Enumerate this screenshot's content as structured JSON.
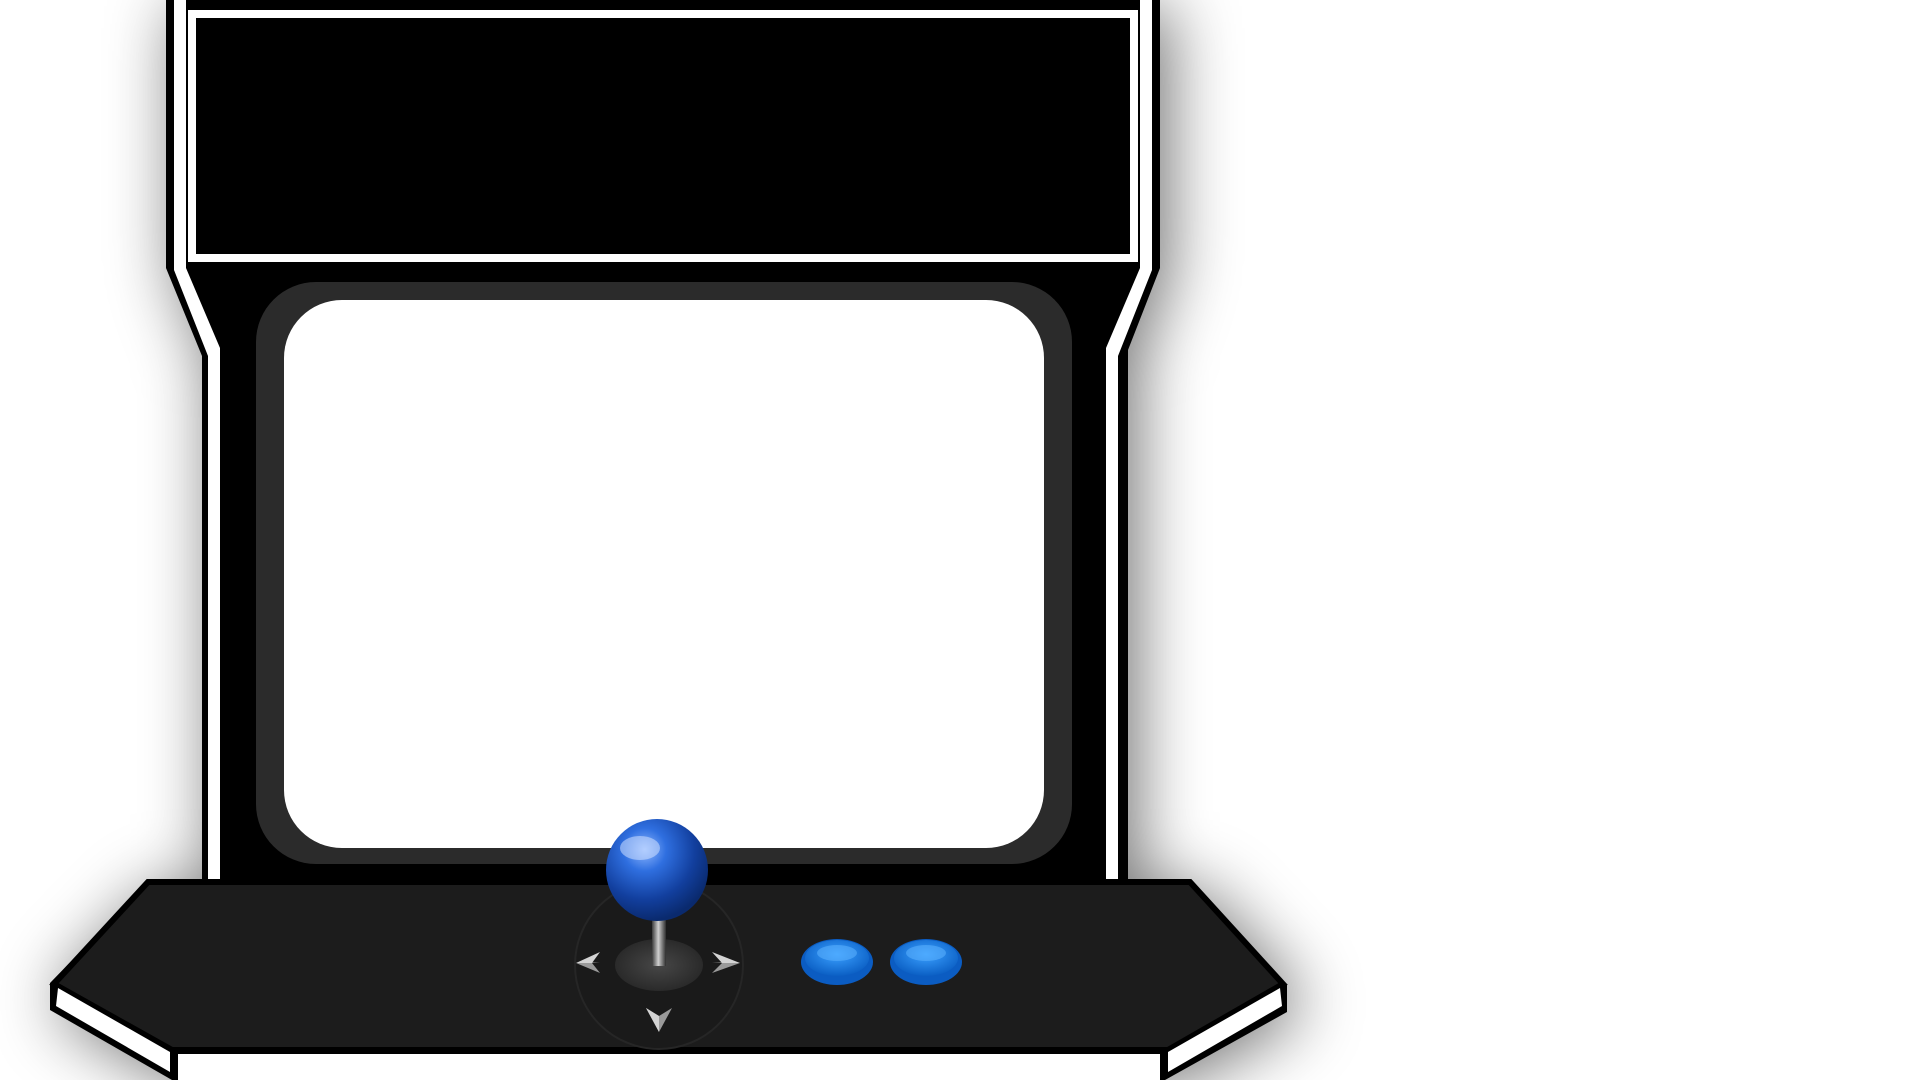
{
  "cabinet": {
    "marquee": {
      "text": ""
    },
    "screen": {
      "text": ""
    },
    "control_panel": {
      "joystick": {
        "directions": [
          "left-arrow",
          "right-arrow",
          "down-arrow"
        ],
        "ball_color": "#1f5fd8"
      },
      "buttons": [
        {
          "name": "action-button-1",
          "color": "#1177e6"
        },
        {
          "name": "action-button-2",
          "color": "#1177e6"
        }
      ]
    }
  },
  "colors": {
    "cabinet_body": "#000000",
    "cabinet_trim": "#ffffff",
    "bezel": "#2b2b2b",
    "control_panel": "#1c1c1c",
    "screen": "#ffffff",
    "accent_blue": "#1177e6"
  }
}
